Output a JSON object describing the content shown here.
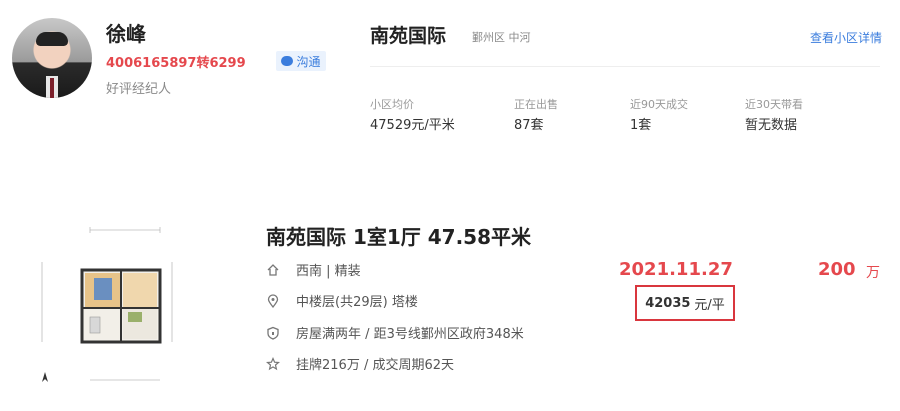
{
  "agent": {
    "name": "徐峰",
    "phone": "4006165897转6299",
    "title": "好评经纪人",
    "chat_label": "沟通"
  },
  "community": {
    "name": "南苑国际",
    "location": "鄞州区 中河",
    "detail_link": "查看小区详情",
    "stats": [
      {
        "label": "小区均价",
        "value": "47529元/平米"
      },
      {
        "label": "正在出售",
        "value": "87套"
      },
      {
        "label": "近90天成交",
        "value": "1套"
      },
      {
        "label": "近30天带看",
        "value": "暂无数据"
      }
    ]
  },
  "listing": {
    "title": "南苑国际 1室1厅 47.58平米",
    "orientation": "西南 | 精装",
    "floor": "中楼层(共29层) 塔楼",
    "features": "房屋满两年 / 距3号线鄞州区政府348米",
    "listing_info": "挂牌216万 / 成交周期62天",
    "deal_date": "2021.11.27",
    "total_price": "200",
    "total_unit": "万",
    "unit_price": "42035",
    "unit_price_suffix": "元/平"
  },
  "colors": {
    "accent_red": "#e5484d",
    "link_blue": "#3b7ddd",
    "highlight_border": "#d9363e"
  },
  "icons": [
    "house-icon",
    "location-pin-icon",
    "shield-icon",
    "star-icon",
    "message-bubble-icon",
    "compass-icon"
  ]
}
